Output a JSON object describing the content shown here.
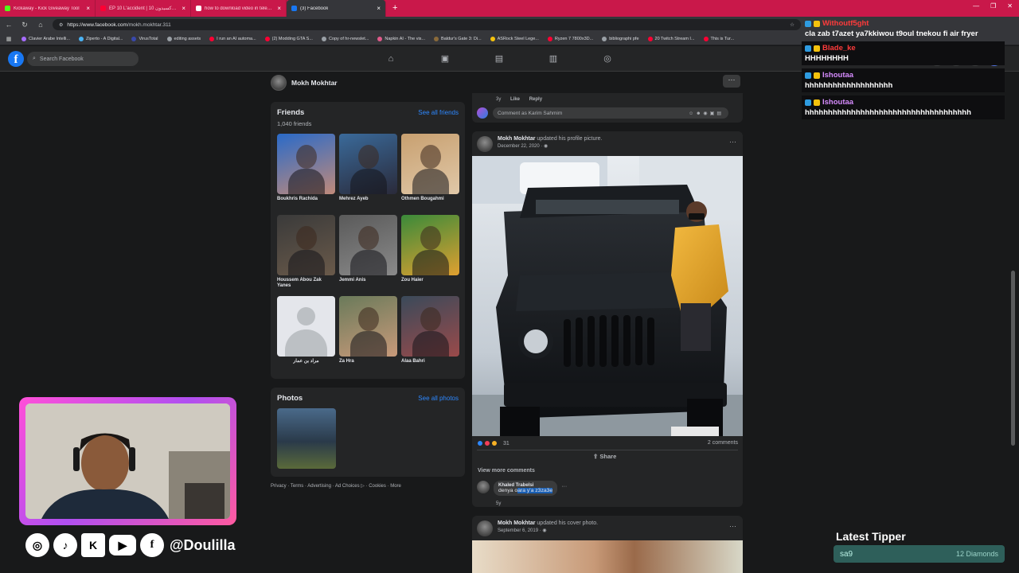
{
  "browser": {
    "tabs": [
      {
        "label": "Kickaway - Kick Giveaway Tool",
        "color": "#53fc18",
        "active": false
      },
      {
        "label": "EP 10 L'accident | الأكسيدون 10 Ai",
        "color": "#ff0033",
        "active": false
      },
      {
        "label": "how to download video in telegra",
        "color": "#ffffff",
        "active": false
      },
      {
        "label": "(3) Facebook",
        "color": "#1877f2",
        "active": true
      }
    ],
    "new_tab": "+",
    "url_host": "https://www.facebook.com",
    "url_path": "/mokh.mokhtar.311",
    "bookmarks": [
      {
        "label": "Clavier Arabe Intelli...",
        "color": "#a66cff"
      },
      {
        "label": "Ziperto - A Digital...",
        "color": "#4ab3f4"
      },
      {
        "label": "VirusTotal",
        "color": "#3949ab"
      },
      {
        "label": "editing assets",
        "color": "#9aa0a6"
      },
      {
        "label": "I run an AI automa...",
        "color": "#ff0033"
      },
      {
        "label": "(2) Modding GTA S...",
        "color": "#ff0033"
      },
      {
        "label": "Copy of hr-newslet...",
        "color": "#9aa0a6"
      },
      {
        "label": "Napkin AI - The vis...",
        "color": "#e05a8a"
      },
      {
        "label": "Baldur's Gate 3: Di...",
        "color": "#8a6a3a"
      },
      {
        "label": "ASRock Steel Lege...",
        "color": "#f4c20d"
      },
      {
        "label": "Ryzen 7 7800x3D...",
        "color": "#ff0033"
      },
      {
        "label": "bibliographi pfe",
        "color": "#9aa0a6"
      },
      {
        "label": "20 Twitch Stream I...",
        "color": "#ff0033"
      },
      {
        "label": "This is Tur...",
        "color": "#ff0033"
      }
    ]
  },
  "facebook": {
    "search_placeholder": "Search Facebook",
    "notif_count": "3",
    "profile_name": "Mokh Mokhtar",
    "friends": {
      "title": "Friends",
      "see_all": "See all friends",
      "count": "1,040 friends",
      "items": [
        {
          "name": "Boukhris Rachida",
          "c1": "#2a6ac8",
          "c2": "#c08a7a"
        },
        {
          "name": "Mehrez Ayeb",
          "c1": "#3a6a9a",
          "c2": "#2a2a3a"
        },
        {
          "name": "Othmen Bougahmi",
          "c1": "#c8a070",
          "c2": "#e0c8a8"
        },
        {
          "name": "Houssem Abou Zak Yanes",
          "c1": "#3a3a3a",
          "c2": "#6a5a4a"
        },
        {
          "name": "Jemmi Anis",
          "c1": "#5a5a5a",
          "c2": "#8a8a8a"
        },
        {
          "name": "Zou Haier",
          "c1": "#3a8a3a",
          "c2": "#e0a030"
        },
        {
          "name": "مراد بن عمار",
          "c1": "#e4e6eb",
          "c2": "#bcc0c4",
          "placeholder": true
        },
        {
          "name": "Za Hra",
          "c1": "#6a7a5a",
          "c2": "#c89a7a"
        },
        {
          "name": "Alaa Bahri",
          "c1": "#3a4a5a",
          "c2": "#9a4a4a"
        }
      ]
    },
    "photos": {
      "title": "Photos",
      "see_all": "See all photos"
    },
    "footer": "Privacy · Terms · Advertising · Ad Choices ▷ · Cookies · More",
    "top_stub": {
      "age": "3y",
      "like": "Like",
      "reply": "Reply",
      "comment_placeholder": "Comment as Karim Sahmim"
    },
    "post": {
      "author": "Mokh Mokhtar",
      "action": "updated his profile picture.",
      "date": "December 22, 2020 · ",
      "reaction_count": "31",
      "comments_count": "2 comments",
      "share": "Share",
      "view_more": "View more comments",
      "comment_author": "Khaled Trabelsi",
      "comment_pre": "denya o",
      "comment_sel": "ara y'a z3za3e",
      "comment_age": "5y"
    },
    "post2": {
      "author": "Mokh Mokhtar",
      "action": "updated his cover photo.",
      "date": "September 6, 2019 · "
    }
  },
  "chat": [
    {
      "user": "Withoutf5ght",
      "color": "#ff3b3b",
      "text": "cla zab t7azet ya7kkiwou t9oul tnekou fi air fryer",
      "first": true
    },
    {
      "user": "Blade_ke",
      "color": "#ff3b3b",
      "text": "HHHHHHHH"
    },
    {
      "user": "Ishoutaa",
      "color": "#d78cff",
      "text": "hhhhhhhhhhhhhhhhhhh"
    },
    {
      "user": "Ishoutaa",
      "color": "#d78cff",
      "text": "hhhhhhhhhhhhhhhhhhhhhhhhhhhhhhhhhhhh"
    }
  ],
  "stream": {
    "handle": "@Doulilla",
    "tipper_title": "Latest Tipper",
    "tipper_name": "sa9",
    "tipper_amount": "12 Diamonds"
  }
}
